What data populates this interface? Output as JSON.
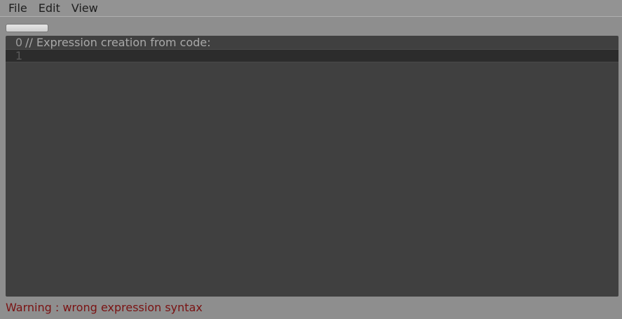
{
  "menubar": {
    "items": [
      "File",
      "Edit",
      "View"
    ]
  },
  "editor": {
    "lines": [
      {
        "number": "0",
        "text": "// Expression creation from code:"
      },
      {
        "number": "1",
        "text": ""
      }
    ]
  },
  "status": {
    "message": "Warning : wrong expression syntax",
    "color": "#7a1212"
  },
  "colors": {
    "background": "#8e8e8e",
    "editor_background": "#404040",
    "current_line": "#2c2c2c"
  }
}
